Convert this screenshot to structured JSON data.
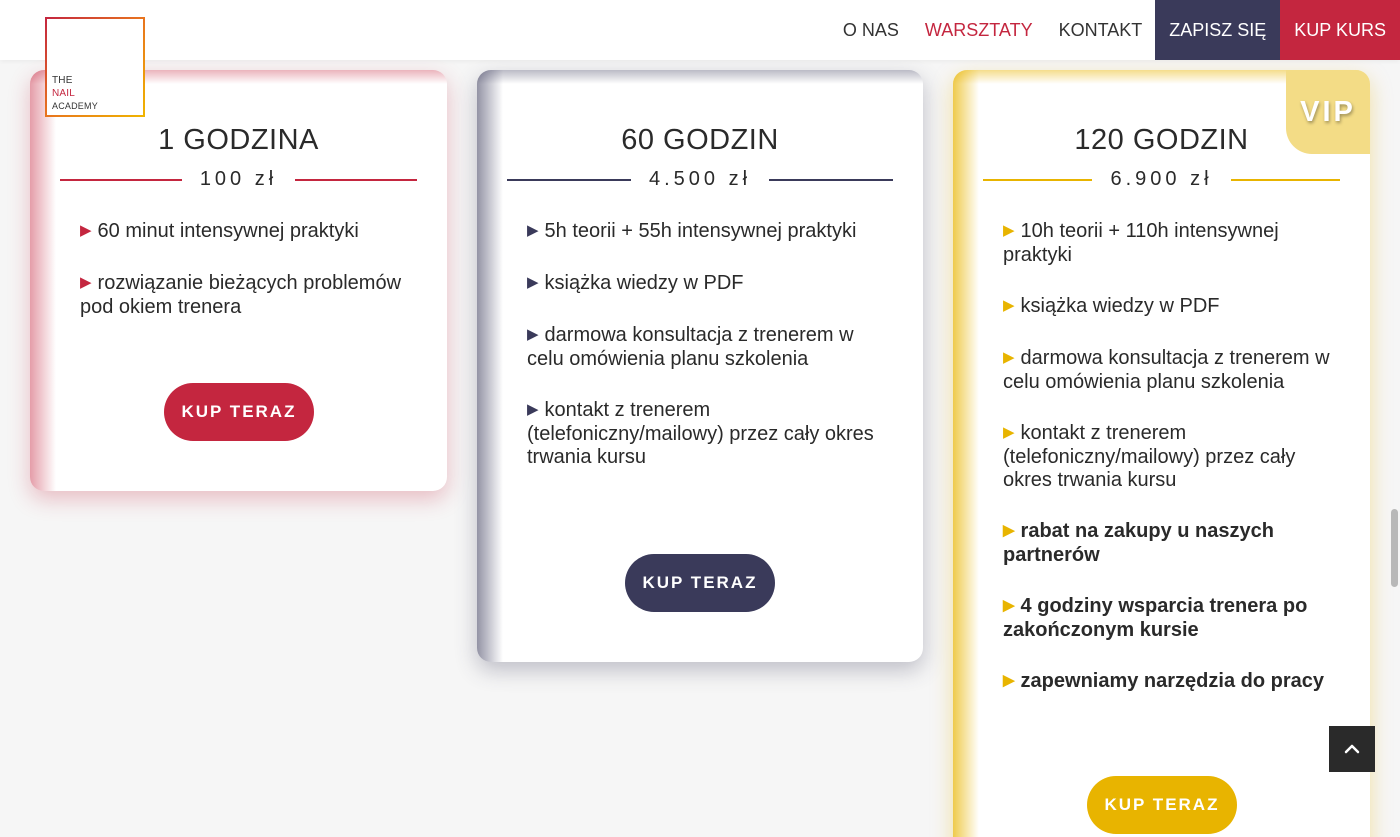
{
  "logo": {
    "line1": "THE",
    "line2": "NAIL",
    "line3": "ACADEMY"
  },
  "nav": {
    "items": [
      {
        "label": "O NAS"
      },
      {
        "label": "WARSZTATY"
      },
      {
        "label": "KONTAKT"
      },
      {
        "label": "ZAPISZ SIĘ"
      },
      {
        "label": "KUP KURS"
      }
    ]
  },
  "plans": [
    {
      "title": "1 GODZINA",
      "price": "100 zł",
      "features": [
        "60 minut intensywnej praktyki",
        "rozwiązanie bieżących problemów pod okiem trenera"
      ],
      "button": "KUP TERAZ"
    },
    {
      "title": "60 GODZIN",
      "price": "4.500 zł",
      "features": [
        "5h teorii + 55h intensywnej praktyki",
        "książka wiedzy w PDF",
        "darmowa konsultacja z trenerem w celu omówienia planu szkolenia",
        "kontakt z trenerem (telefoniczny/mailowy) przez cały okres trwania kursu"
      ],
      "button": "KUP TERAZ"
    },
    {
      "title": "120 GODZIN",
      "price": "6.900 zł",
      "badge": "VIP",
      "features": [
        "10h teorii + 110h intensywnej praktyki",
        "książka wiedzy w PDF",
        "darmowa konsultacja z trenerem w celu omówienia planu szkolenia",
        "kontakt z trenerem (telefoniczny/mailowy) przez cały okres trwania kursu",
        "rabat na zakupy u naszych partnerów",
        "4 godziny wsparcia trenera po zakończonym kursie",
        "zapewniamy narzędzia do pracy"
      ],
      "button": "KUP TERAZ"
    }
  ],
  "colors": {
    "red": "#c4263f",
    "navy": "#3a3a5a",
    "gold": "#e8b400"
  }
}
